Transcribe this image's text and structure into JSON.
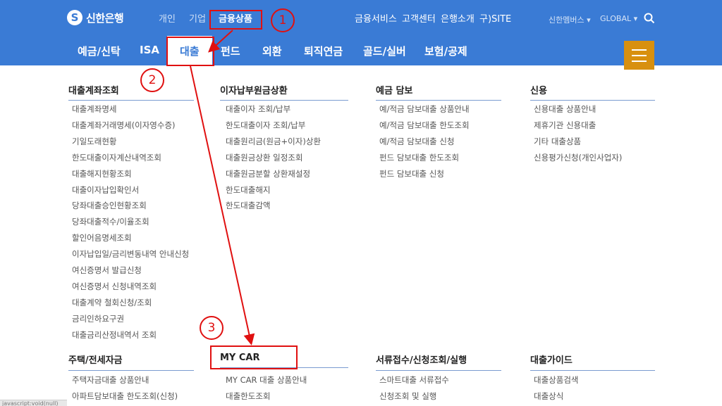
{
  "header": {
    "logo_text": "신한은행",
    "logo_mark": "S",
    "segments": [
      {
        "label": "개인"
      },
      {
        "label": "기업"
      },
      {
        "label": "금융상품"
      }
    ],
    "utility_links": [
      {
        "label": "금융서비스"
      },
      {
        "label": "고객센터"
      },
      {
        "label": "은행소개"
      },
      {
        "label": "구)SITE"
      }
    ],
    "member_label": "신한멤버스 ▾",
    "global_label": "GLOBAL ▾",
    "search_icon": "search-icon"
  },
  "tabs": [
    {
      "label": "예금/신탁"
    },
    {
      "label": "ISA"
    },
    {
      "label": "대출"
    },
    {
      "label": "펀드"
    },
    {
      "label": "외환"
    },
    {
      "label": "퇴직연금"
    },
    {
      "label": "골드/실버"
    },
    {
      "label": "보험/공제"
    }
  ],
  "menu_icon": "hamburger-menu-icon",
  "accent_color": "#3a7bd5",
  "hamburger_color": "#d8900f",
  "sections_top": [
    {
      "heading": "대출계좌조회",
      "items": [
        "대출계좌명세",
        "대출계좌거래명세(이자영수증)",
        "기일도래현황",
        "한도대출이자계산내역조회",
        "대출해지현황조회",
        "대출이자납입확인서",
        "당좌대출승인현황조회",
        "당좌대출적수/이율조회",
        "할인어음명세조회",
        "이자납입일/금리변동내역 안내신청",
        "여신증명서 발급신청",
        "여신증명서 신청내역조회",
        "대출계약 철회신청/조회",
        "금리인하요구권",
        "대출금리산정내역서 조회"
      ]
    },
    {
      "heading": "이자납부원금상환",
      "items": [
        "대출이자 조회/납부",
        "한도대출이자 조회/납부",
        "대출원리금(원금+이자)상환",
        "대출원금상환 일정조회",
        "대출원금분할 상환재설정",
        "한도대출해지",
        "한도대출감액"
      ]
    },
    {
      "heading": "예금 담보",
      "items": [
        "예/적금 담보대출 상품안내",
        "예/적금 담보대출 한도조회",
        "예/적금 담보대출 신청",
        "펀드 담보대출 한도조회",
        "펀드 담보대출 신청"
      ]
    },
    {
      "heading": "신용",
      "items": [
        "신용대출 상품안내",
        "제휴기관 신용대출",
        "기타 대출상품",
        "신용평가신청(개인사업자)"
      ]
    }
  ],
  "sections_bottom": [
    {
      "heading": "주택/전세자금",
      "items": [
        "주택자금대출 상품안내",
        "아파트담보대출 한도조회(신청)"
      ]
    },
    {
      "heading": "MY CAR",
      "items": [
        "MY CAR 대출 상품안내",
        "대출한도조회"
      ]
    },
    {
      "heading": "서류접수/신청조회/실행",
      "items": [
        "스마트대출 서류접수",
        "신청조회 및 실행"
      ]
    },
    {
      "heading": "대출가이드",
      "items": [
        "대출상품검색",
        "대출상식"
      ]
    }
  ],
  "annotations": {
    "step1": "1",
    "step2": "2",
    "step3": "3",
    "color": "#e01010"
  },
  "status_bar": "javascript:void(null)"
}
